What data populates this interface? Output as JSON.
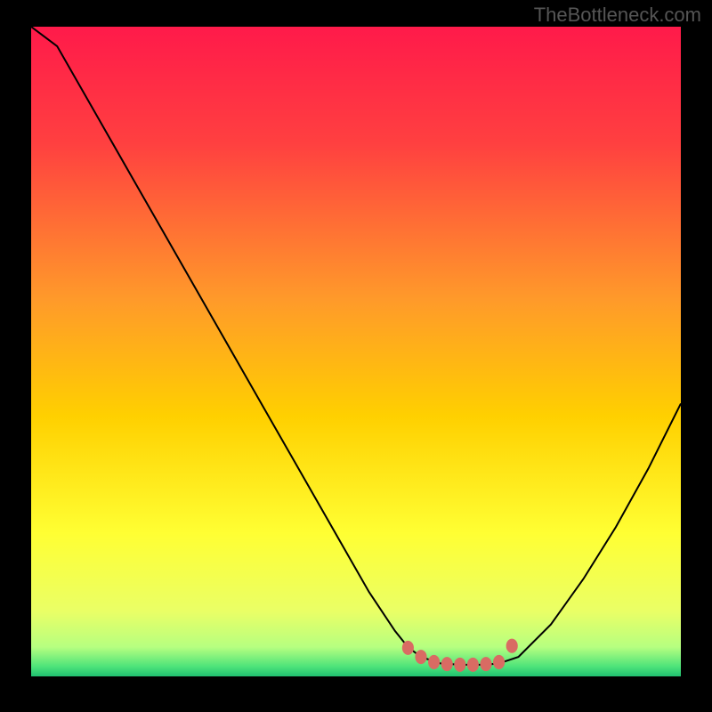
{
  "watermark": "TheBottleneck.com",
  "chart_data": {
    "type": "line",
    "title": "",
    "xlabel": "",
    "ylabel": "",
    "xlim": [
      0,
      100
    ],
    "ylim": [
      0,
      100
    ],
    "grid": false,
    "legend": false,
    "background_gradient": {
      "stops": [
        {
          "pos": 0.0,
          "color": "#ff1a4a"
        },
        {
          "pos": 0.18,
          "color": "#ff4040"
        },
        {
          "pos": 0.42,
          "color": "#ff9a2a"
        },
        {
          "pos": 0.6,
          "color": "#ffd000"
        },
        {
          "pos": 0.78,
          "color": "#ffff33"
        },
        {
          "pos": 0.9,
          "color": "#eaff66"
        },
        {
          "pos": 0.955,
          "color": "#b6ff80"
        },
        {
          "pos": 0.985,
          "color": "#4de37a"
        },
        {
          "pos": 1.0,
          "color": "#20c070"
        }
      ]
    },
    "series": [
      {
        "name": "bottleneck-curve",
        "x": [
          0,
          4,
          8,
          12,
          16,
          20,
          24,
          28,
          32,
          36,
          40,
          44,
          48,
          52,
          56,
          58,
          60,
          63,
          66,
          70,
          72,
          75,
          80,
          85,
          90,
          95,
          100
        ],
        "y": [
          104,
          97,
          90,
          83,
          76,
          69,
          62,
          55,
          48,
          41,
          34,
          27,
          20,
          13,
          7,
          4.5,
          3,
          2,
          1.8,
          1.8,
          2,
          3,
          8,
          15,
          23,
          32,
          42
        ]
      }
    ],
    "optimal_markers": {
      "color": "#d96b63",
      "points": [
        {
          "x": 58,
          "y": 4.4
        },
        {
          "x": 60,
          "y": 3.0
        },
        {
          "x": 62,
          "y": 2.2
        },
        {
          "x": 64,
          "y": 1.9
        },
        {
          "x": 66,
          "y": 1.8
        },
        {
          "x": 68,
          "y": 1.8
        },
        {
          "x": 70,
          "y": 1.9
        },
        {
          "x": 72,
          "y": 2.2
        },
        {
          "x": 74,
          "y": 4.7
        }
      ]
    }
  }
}
